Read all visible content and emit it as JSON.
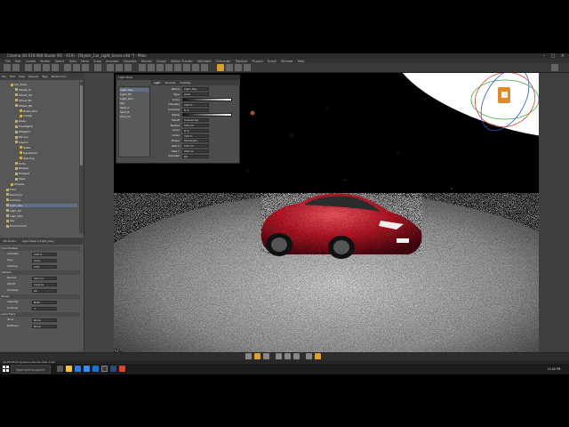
{
  "app": {
    "title": "Cinema 4D R19.068 Studio (RC - R19) - [Stylish_Car_Light_Scene.c4d *] - Main",
    "window_controls": [
      "–",
      "□",
      "×"
    ]
  },
  "menubar": [
    "File",
    "Edit",
    "Create",
    "Modes",
    "Select",
    "Tools",
    "Mesh",
    "Snap",
    "Animate",
    "Simulate",
    "Render",
    "Sculpt",
    "Motion Tracker",
    "MoGraph",
    "Character",
    "Pipeline",
    "Plugins",
    "Script",
    "Window",
    "Help"
  ],
  "outliner": {
    "menu": [
      "File",
      "Edit",
      "View",
      "Objects",
      "Tags",
      "Bookmarks"
    ],
    "items": [
      {
        "label": "Car_Body",
        "indent": 2
      },
      {
        "label": "Wheel_FL",
        "indent": 3
      },
      {
        "label": "Wheel_FR",
        "indent": 3
      },
      {
        "label": "Wheel_RL",
        "indent": 3
      },
      {
        "label": "Wheel_RR",
        "indent": 3
      },
      {
        "label": "Brake_Disc",
        "indent": 4
      },
      {
        "label": "Caliper",
        "indent": 4
      },
      {
        "label": "Glass",
        "indent": 3
      },
      {
        "label": "Headlights",
        "indent": 3
      },
      {
        "label": "Taillights",
        "indent": 3
      },
      {
        "label": "Mirrors",
        "indent": 3
      },
      {
        "label": "Interior",
        "indent": 3
      },
      {
        "label": "Seats",
        "indent": 4
      },
      {
        "label": "Dashboard",
        "indent": 4
      },
      {
        "label": "Steering",
        "indent": 4
      },
      {
        "label": "Grille",
        "indent": 3
      },
      {
        "label": "Badges",
        "indent": 3
      },
      {
        "label": "Exhaust",
        "indent": 3
      },
      {
        "label": "Plate",
        "indent": 3
      },
      {
        "label": "Chassis",
        "indent": 2
      },
      {
        "label": "Floor",
        "indent": 1
      },
      {
        "label": "Backdrop",
        "indent": 1
      },
      {
        "label": "Camera",
        "indent": 1
      },
      {
        "label": "Light_Key",
        "indent": 1,
        "selected": true
      },
      {
        "label": "Light_Fill",
        "indent": 1
      },
      {
        "label": "Light_Rim",
        "indent": 1
      },
      {
        "label": "Sky",
        "indent": 1
      },
      {
        "label": "Environment",
        "indent": 1
      }
    ]
  },
  "attributes": {
    "header": "Attributes",
    "tab": "Light Object [Light_Key]",
    "sections": [
      {
        "label": "Coordinates",
        "rows": [
          "Intensity",
          "Type",
          "Shadow"
        ]
      },
      {
        "label": "Details",
        "rows": [
          "Radius",
          "Falloff",
          "Samples"
        ]
      },
      {
        "label": "Noise",
        "rows": [
          "Visibility",
          "Octaves"
        ]
      },
      {
        "label": "Lens Flare",
        "rows": [
          "Glow",
          "Reflexes"
        ]
      }
    ],
    "values": [
      "100 %",
      "Area",
      "Soft",
      "200 cm",
      "Inverse",
      "64",
      "Both",
      "3",
      "None",
      "None"
    ]
  },
  "light_window": {
    "title": "Light Mixer",
    "tabs": [
      "Light",
      "Shadow",
      "Visibility"
    ],
    "list": [
      "Light_Key",
      "Light_Fill",
      "Light_Rim",
      "Sky",
      "Spot_A",
      "Spot_B",
      "Area_01"
    ],
    "list_selected": 0,
    "fields": [
      "Name",
      "Type",
      "Color",
      "Intensity",
      "Contrast",
      "Ramp",
      "Falloff",
      "Radius",
      "Inner",
      "Outer",
      "Shape",
      "Size X",
      "Size Y",
      "Samples"
    ],
    "values": [
      "Light_Key",
      "Area",
      "255",
      "100 %",
      "0 %",
      "",
      "Inverse Sq",
      "500 cm",
      "0 %",
      "100 %",
      "Rectangle",
      "200 cm",
      "200 cm",
      "64"
    ]
  },
  "status": {
    "text": "00:00:06  Progressive Render  Pass 1/64"
  },
  "taskbar": {
    "search_placeholder": "Type here to search",
    "clock": "12:40 PM"
  },
  "colors": {
    "accent": "#e0a030",
    "car_red": "#c0182a",
    "selection": "#5f6f8a"
  }
}
